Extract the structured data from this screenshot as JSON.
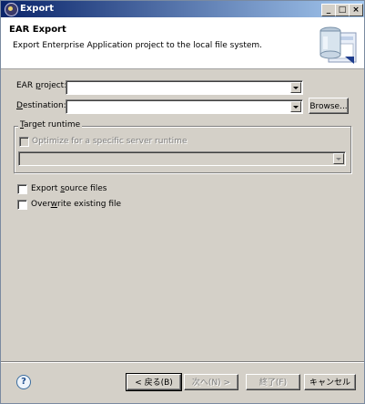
{
  "window": {
    "title": "Export",
    "controls": {
      "minimize": "_",
      "maximize": "□",
      "close": "×"
    }
  },
  "header": {
    "title": "EAR Export",
    "description": "Export Enterprise Application project to the local file system."
  },
  "form": {
    "ear_project": {
      "label_access": "EAR ",
      "label_mnemonic": "p",
      "label_rest": "roject:",
      "value": ""
    },
    "destination": {
      "label_mnemonic": "D",
      "label_rest": "estination:",
      "value": ""
    },
    "browse_label": "Browse..."
  },
  "target_runtime": {
    "legend_mnemonic": "T",
    "legend_rest": "arget runtime",
    "optimize_label": "Optimize for a specific server runtime",
    "runtime_value": ""
  },
  "options": {
    "export_source": {
      "pre": "Export ",
      "mnemonic": "s",
      "post": "ource files",
      "checked": false
    },
    "overwrite": {
      "pre": "Over",
      "mnemonic": "w",
      "post": "rite existing file",
      "checked": false
    }
  },
  "buttons": {
    "back": "< 戻る(B)",
    "next": "次へ(N) >",
    "finish": "終了(F)",
    "cancel": "キャンセル"
  },
  "icons": {
    "help": "?",
    "help_icon": "help-icon",
    "wizard_graphic": "export-wizard-jar-icon"
  }
}
